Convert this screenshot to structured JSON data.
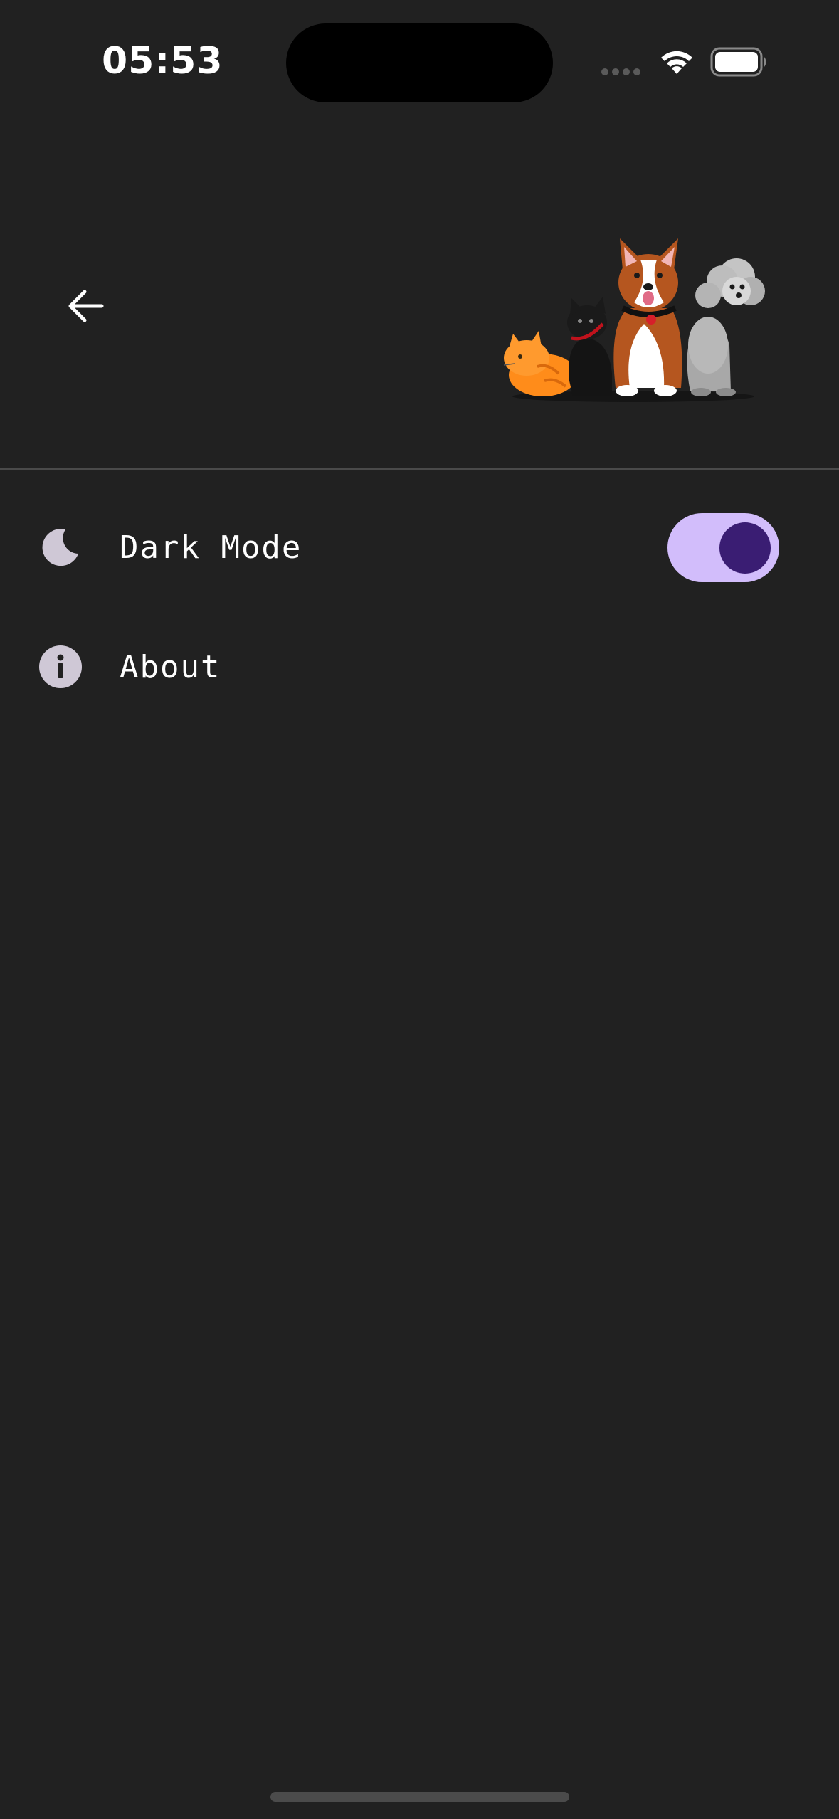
{
  "status_bar": {
    "time": "05:53",
    "icons": [
      "signal-dots-icon",
      "wifi-icon",
      "battery-icon"
    ]
  },
  "header": {
    "back_icon": "arrow-left-icon",
    "illustration": "pets-illustration"
  },
  "settings": {
    "items": [
      {
        "label": "Dark Mode",
        "icon": "moon-icon",
        "toggle_on": true
      },
      {
        "label": "About",
        "icon": "info-icon"
      }
    ]
  },
  "colors": {
    "background": "#212121",
    "toggle_track": "#d2bdfb",
    "toggle_knob": "#3a1d73",
    "icon_tint": "#cfc8d6",
    "divider": "#4a4a4a"
  }
}
